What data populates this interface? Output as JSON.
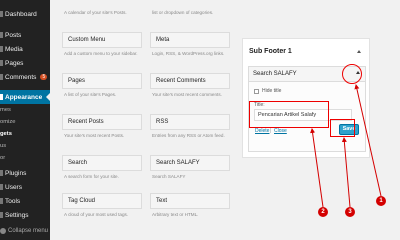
{
  "sidebar": {
    "items": [
      {
        "label": "Dashboard"
      },
      {
        "label": "Posts"
      },
      {
        "label": "Media"
      },
      {
        "label": "Pages"
      },
      {
        "label": "Comments",
        "badge": "5"
      },
      {
        "label": "Appearance"
      }
    ],
    "subitems": [
      {
        "label": "mes"
      },
      {
        "label": "omize"
      },
      {
        "label": "gets"
      },
      {
        "label": "us"
      },
      {
        "label": "or"
      }
    ],
    "items_bottom": [
      {
        "label": "Plugins"
      },
      {
        "label": "Users"
      },
      {
        "label": "Tools"
      },
      {
        "label": "Settings"
      }
    ],
    "collapse_label": "Collapse menu"
  },
  "widgets": {
    "top_descriptions": [
      "A calendar of your site's Posts.",
      "list or dropdown of categories."
    ],
    "rows": [
      [
        {
          "name": "Custom Menu",
          "desc": "Add a custom menu to your sidebar."
        },
        {
          "name": "Meta",
          "desc": "Login, RSS, & WordPress.org links."
        }
      ],
      [
        {
          "name": "Pages",
          "desc": "A list of your site's Pages."
        },
        {
          "name": "Recent Comments",
          "desc": "Your site's most recent comments."
        }
      ],
      [
        {
          "name": "Recent Posts",
          "desc": "Your site's most recent Posts."
        },
        {
          "name": "RSS",
          "desc": "Entries from any RSS or Atom feed."
        }
      ],
      [
        {
          "name": "Search",
          "desc": "A search form for your site."
        },
        {
          "name": "Search SALAFY",
          "desc": "Search SALAFY"
        }
      ],
      [
        {
          "name": "Tag Cloud",
          "desc": "A cloud of your most used tags."
        },
        {
          "name": "Text",
          "desc": "Arbitrary text or HTML."
        }
      ]
    ]
  },
  "panel": {
    "title": "Sub Footer 1",
    "widget_title": "Search SALAFY",
    "checkbox_label": "Hide title",
    "field_label": "Title:",
    "field_value": "Pencarian Artikel Salafy",
    "delete_label": "Delete",
    "separator": "|",
    "close_label": "Close",
    "save_label": "Save"
  },
  "annotations": {
    "callouts": [
      "1",
      "2",
      "3"
    ],
    "color": "#d40000"
  },
  "colors": {
    "sidebar_bg": "#222222",
    "active_menu": "#0074a2",
    "save_button": "#2ea2cc",
    "comments_badge": "#d54e21"
  }
}
